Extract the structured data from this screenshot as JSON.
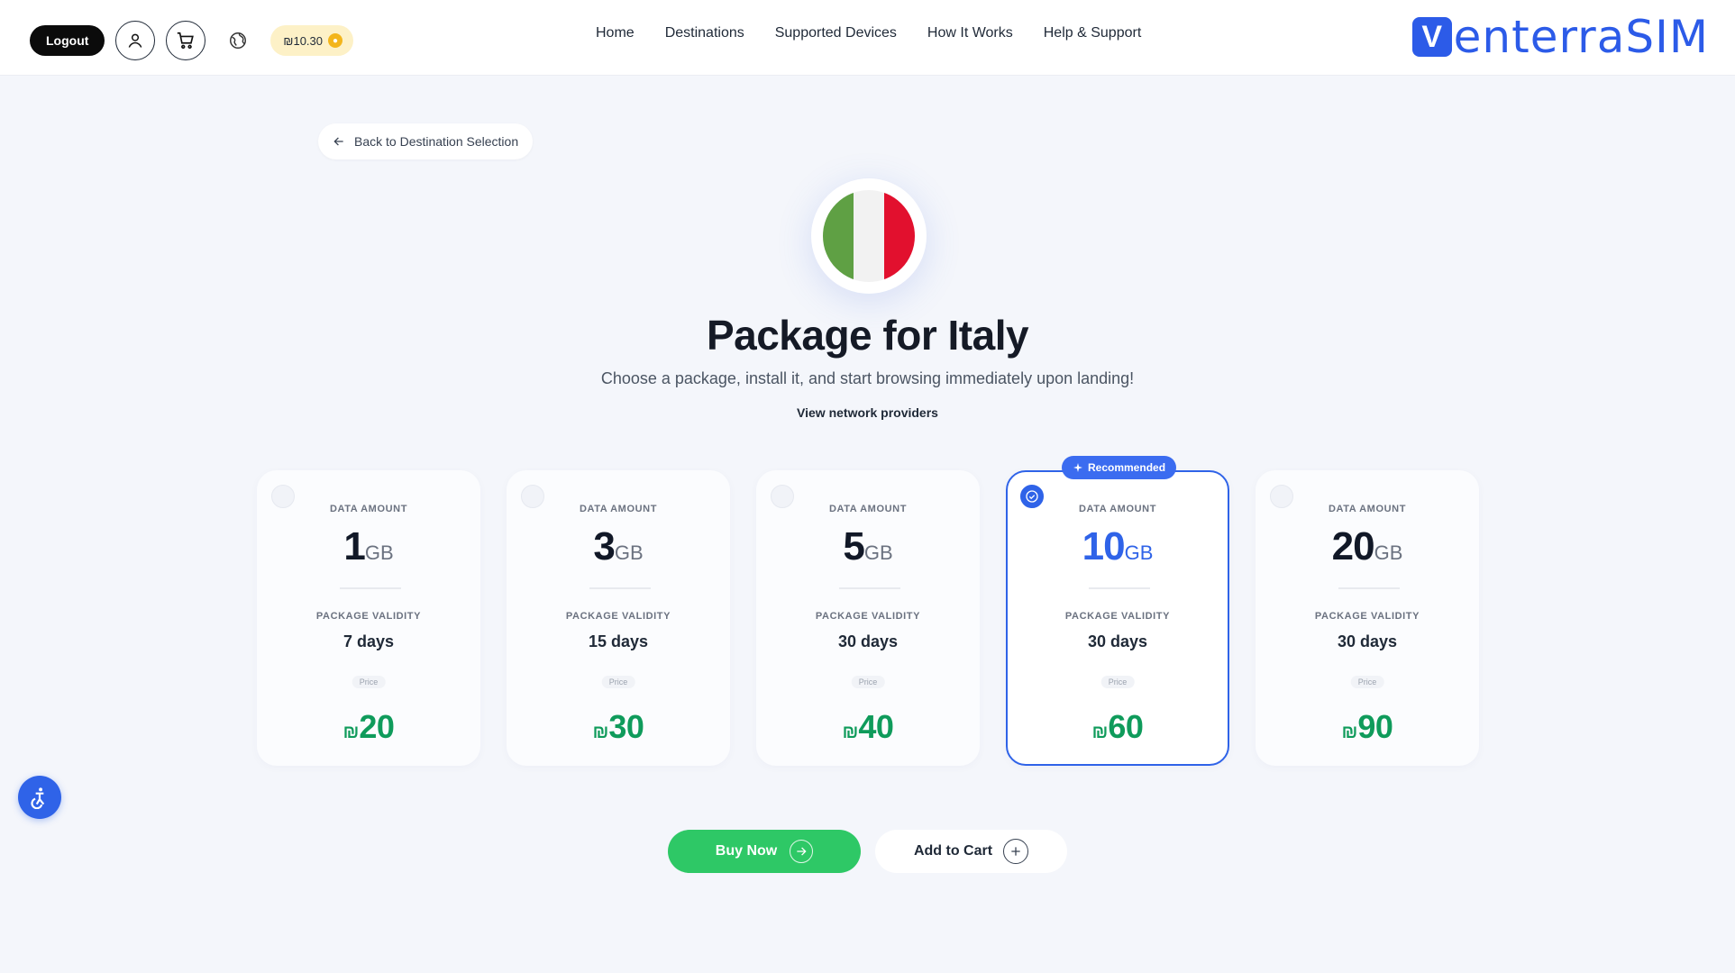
{
  "header": {
    "logout_label": "Logout",
    "balance": "₪10.30",
    "nav": [
      "Home",
      "Destinations",
      "Supported Devices",
      "How It Works",
      "Help & Support"
    ],
    "brand_text": "enterraSIM",
    "brand_mark": "V"
  },
  "back_label": "Back to Destination Selection",
  "page": {
    "title": "Package for Italy",
    "subtitle": "Choose a package, install it, and start browsing immediately upon landing!",
    "providers_link": "View network providers",
    "flag_colors": [
      "#5fa044",
      "#f2f2f2",
      "#e2102e"
    ]
  },
  "labels": {
    "data_amount": "DATA AMOUNT",
    "package_validity": "PACKAGE VALIDITY",
    "price": "Price",
    "currency": "₪",
    "unit": "GB",
    "recommended": "Recommended"
  },
  "packages": [
    {
      "amount": "1",
      "validity": "7 days",
      "price": "20",
      "selected": false
    },
    {
      "amount": "3",
      "validity": "15 days",
      "price": "30",
      "selected": false
    },
    {
      "amount": "5",
      "validity": "30 days",
      "price": "40",
      "selected": false
    },
    {
      "amount": "10",
      "validity": "30 days",
      "price": "60",
      "selected": true
    },
    {
      "amount": "20",
      "validity": "30 days",
      "price": "90",
      "selected": false
    }
  ],
  "actions": {
    "buy_now": "Buy Now",
    "add_to_cart": "Add to Cart"
  },
  "colors": {
    "accent": "#2f63e8",
    "price_green": "#0f9b5b",
    "buy_green": "#2ec866",
    "balance_chip": "#fdf1c7"
  }
}
